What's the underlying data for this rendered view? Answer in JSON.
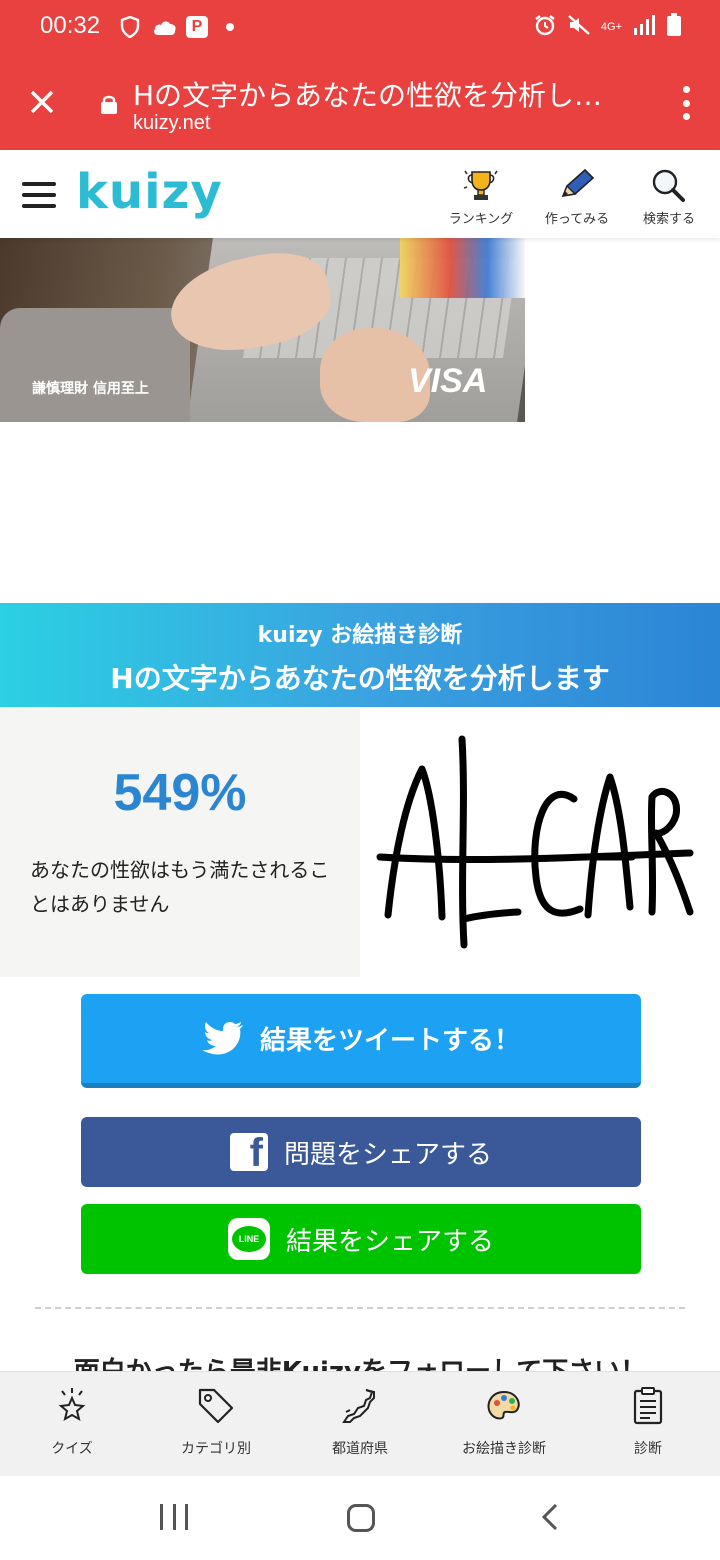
{
  "status_bar": {
    "time": "00:32",
    "network_label": "4G+",
    "icons": [
      "shield-icon",
      "cloud-icon",
      "p-icon",
      "dot-icon",
      "alarm-icon",
      "mute-icon",
      "wifi-icon",
      "signal-icon",
      "battery-icon"
    ]
  },
  "browser": {
    "page_title": "Hの文字からあなたの性欲を分析し…",
    "url": "kuizy.net"
  },
  "site_header": {
    "logo": "kuizy",
    "nav": [
      {
        "label": "ランキング",
        "icon": "trophy-icon"
      },
      {
        "label": "作ってみる",
        "icon": "pencil-icon"
      },
      {
        "label": "検索する",
        "icon": "search-icon"
      }
    ]
  },
  "ad": {
    "caption": "謙慎理財 信用至上",
    "brand": "VISA"
  },
  "banner": {
    "subtitle": "kuizy お絵描き診断",
    "title": "Hの文字からあなたの性欲を分析します"
  },
  "result": {
    "score": "549%",
    "description": "あなたの性欲はもう満たされることはありません"
  },
  "share": {
    "twitter": "結果をツイートする！",
    "facebook": "問題をシェアする",
    "line": "結果をシェアする",
    "line_icon_text": "LINE"
  },
  "follow_text": "面白かったら是非Kuizyをフォローして下さい！",
  "bottom_nav": [
    {
      "label": "クイズ",
      "icon": "star-icon"
    },
    {
      "label": "カテゴリ別",
      "icon": "tag-icon"
    },
    {
      "label": "都道府県",
      "icon": "map-japan-icon"
    },
    {
      "label": "お絵描き診断",
      "icon": "palette-icon"
    },
    {
      "label": "診断",
      "icon": "clipboard-icon"
    }
  ],
  "colors": {
    "browser_bar": "#e8413f",
    "logo": "#2bbcd4",
    "score": "#2a86d1",
    "twitter": "#1da1f2",
    "facebook": "#3b5998",
    "line": "#00c300"
  }
}
